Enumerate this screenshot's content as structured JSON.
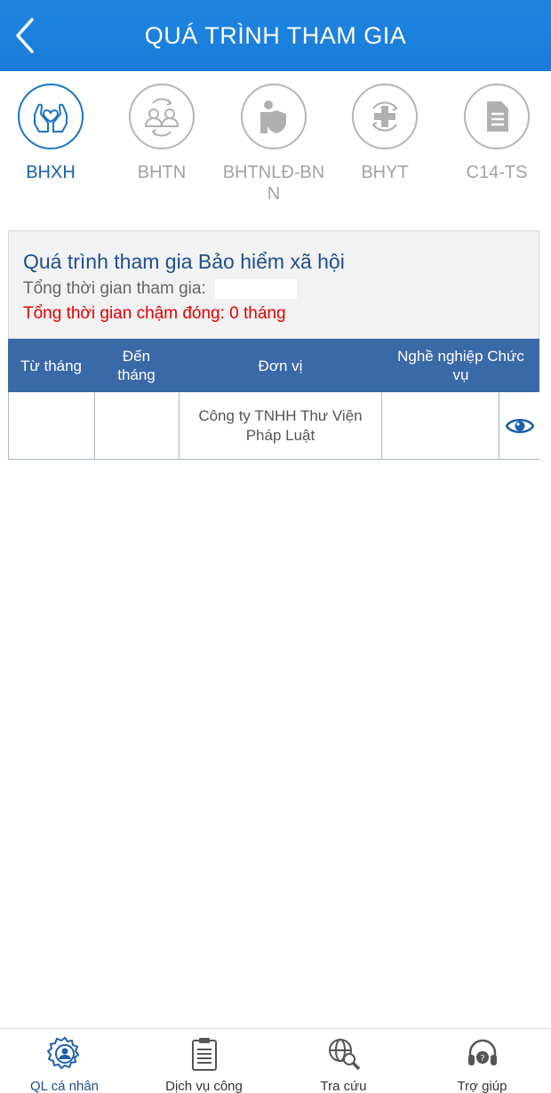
{
  "header": {
    "title": "QUÁ TRÌNH THAM GIA"
  },
  "tabs": [
    {
      "label": "BHXH",
      "icon": "heart-hands-icon",
      "active": true
    },
    {
      "label": "BHTN",
      "icon": "people-exchange-icon",
      "active": false
    },
    {
      "label": "BHTNLĐ-BNN",
      "icon": "worker-shield-icon",
      "active": false
    },
    {
      "label": "BHYT",
      "icon": "medical-cross-icon",
      "active": false
    },
    {
      "label": "C14-TS",
      "icon": "document-icon",
      "active": false
    }
  ],
  "summary": {
    "title": "Quá trình tham gia Bảo hiểm xã hội",
    "total_label": "Tổng thời gian tham gia:",
    "late_label": "Tổng thời gian chậm đóng: 0 tháng"
  },
  "table": {
    "headers": [
      "Từ tháng",
      "Đến tháng",
      "Đơn vị",
      "Nghề nghiệp Chức vụ",
      ""
    ],
    "rows": [
      {
        "from": "",
        "to": "",
        "unit": "Công ty TNHH Thư Viện Pháp Luật",
        "job": "",
        "action_icon": "eye-icon"
      }
    ]
  },
  "bottom_nav": [
    {
      "label": "QL cá nhân",
      "icon": "gear-user-icon",
      "active": true
    },
    {
      "label": "Dịch vụ công",
      "icon": "clipboard-icon",
      "active": false
    },
    {
      "label": "Tra cứu",
      "icon": "globe-search-icon",
      "active": false
    },
    {
      "label": "Trợ giúp",
      "icon": "headset-icon",
      "active": false
    }
  ],
  "colors": {
    "header": "#1a7bd8",
    "active": "#1a73c7",
    "table_header": "#3a69a8",
    "late": "#e00000"
  }
}
